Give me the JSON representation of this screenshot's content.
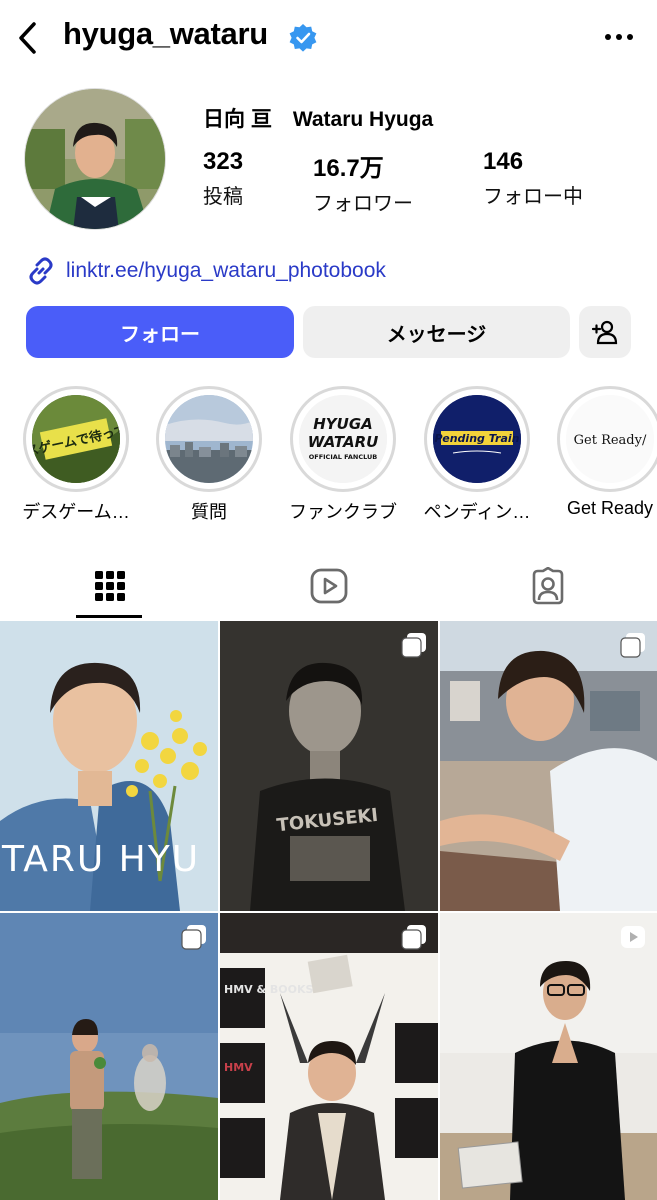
{
  "header": {
    "username": "hyuga_wataru",
    "verified_icon": "verified-badge-icon",
    "back_icon": "chevron-left-icon",
    "more_icon": "more-horizontal-icon"
  },
  "profile": {
    "display_name": "日向 亘　Wataru Hyuga",
    "stats": [
      {
        "value": "323",
        "label": "投稿"
      },
      {
        "value": "16.7万",
        "label": "フォロワー"
      },
      {
        "value": "146",
        "label": "フォロー中"
      }
    ],
    "link": "linktr.ee/hyuga_wataru_photobook",
    "link_icon": "link-icon"
  },
  "actions": {
    "follow_label": "フォロー",
    "message_label": "メッセージ",
    "add_icon": "add-person-icon"
  },
  "highlights": [
    {
      "label": "デスゲーム…",
      "cover_text": "デスゲームで待ってる"
    },
    {
      "label": "質問",
      "cover_text": ""
    },
    {
      "label": "ファンクラブ",
      "cover_text_1": "HYUGA",
      "cover_text_2": "WATARU",
      "cover_text_3": "OFFICIAL FANCLUB"
    },
    {
      "label": "ペンディン…",
      "cover_text": "Pending Train"
    },
    {
      "label": "Get Ready",
      "cover_text": "Get Ready/"
    }
  ],
  "tabs": [
    {
      "name": "grid-icon",
      "active": true
    },
    {
      "name": "reels-icon",
      "active": false
    },
    {
      "name": "tagged-icon",
      "active": false
    }
  ],
  "posts": [
    {
      "id": "post-1",
      "type": "image",
      "overlay_text": "TARU HYU"
    },
    {
      "id": "post-2",
      "type": "carousel",
      "overlay_text": "TOKUSEKI"
    },
    {
      "id": "post-3",
      "type": "carousel",
      "overlay_text": ""
    },
    {
      "id": "post-4",
      "type": "carousel",
      "overlay_text": ""
    },
    {
      "id": "post-5",
      "type": "carousel",
      "overlay_text": "HMV & BOOKS"
    },
    {
      "id": "post-6",
      "type": "reel",
      "overlay_text": ""
    }
  ],
  "colors": {
    "accent": "#4a5df9",
    "link": "#2a3ac7",
    "verified": "#3797f0",
    "button_secondary": "#efefef"
  }
}
